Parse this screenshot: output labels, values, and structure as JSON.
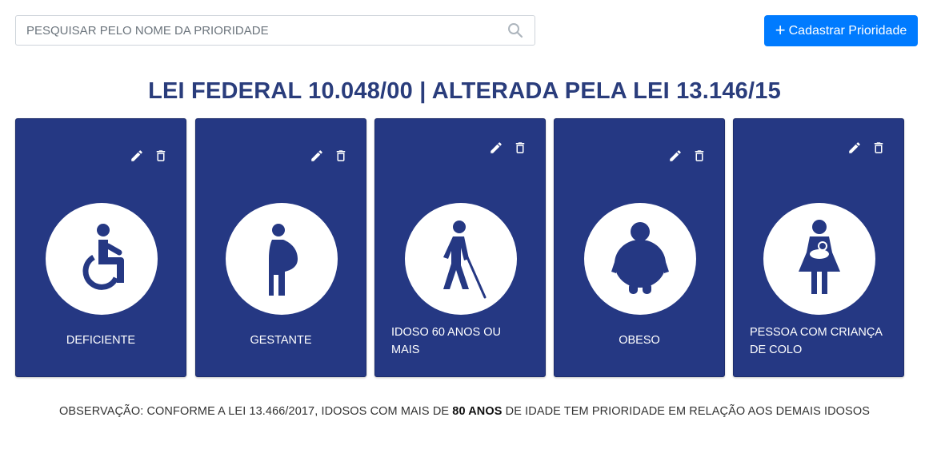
{
  "search": {
    "placeholder": "PESQUISAR PELO NOME DA PRIORIDADE",
    "value": ""
  },
  "add_button": {
    "label": "Cadastrar Prioridade",
    "icon": "plus-icon"
  },
  "title": "LEI FEDERAL 10.048/00 | ALTERADA PELA LEI 13.146/15",
  "colors": {
    "card_bg": "#253883",
    "title": "#2a3d7c",
    "primary_button": "#007bff"
  },
  "cards": [
    {
      "label": "DEFICIENTE",
      "icon": "wheelchair-icon"
    },
    {
      "label": "GESTANTE",
      "icon": "pregnant-woman-icon"
    },
    {
      "label": "IDOSO 60 ANOS OU MAIS",
      "icon": "elderly-blind-icon"
    },
    {
      "label": "OBESO",
      "icon": "obese-person-icon"
    },
    {
      "label": "PESSOA COM CRIANÇA DE COLO",
      "icon": "person-with-baby-icon"
    }
  ],
  "observation": {
    "before": "OBSERVAÇÃO: CONFORME A LEI 13.466/2017, IDOSOS COM MAIS DE ",
    "bold": "80 ANOS",
    "after": " DE IDADE TEM PRIORIDADE EM RELAÇÃO AOS DEMAIS IDOSOS"
  }
}
